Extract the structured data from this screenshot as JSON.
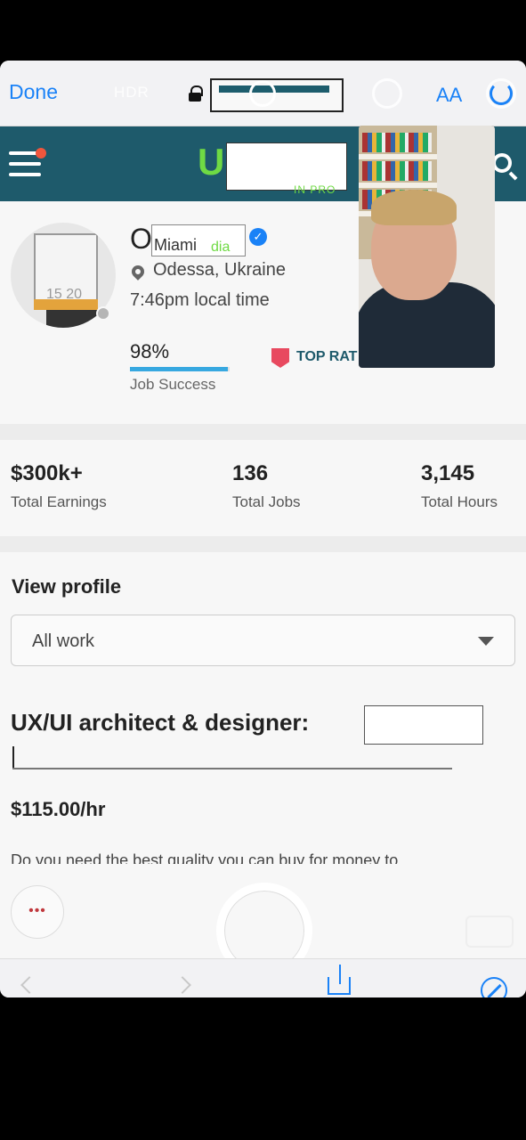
{
  "browser": {
    "done_label": "Done",
    "hdr_label": "HDR",
    "text_size_label": "AA",
    "accent": "#1a82f7"
  },
  "site": {
    "logo_text": "U",
    "logo_sub": "IN PRO",
    "header_color": "#1e5a6b",
    "brand_green": "#6fda44"
  },
  "profile": {
    "name_initial": "O",
    "name_overlay": "Miami",
    "name_overlay_suffix": "dia",
    "avatar_numbers": "15 20",
    "location": "Odessa, Ukraine",
    "local_time": "7:46pm local time",
    "job_success_value": "98%",
    "job_success_fraction": 0.98,
    "job_success_label": "Job Success",
    "badge_label": "TOP RAT"
  },
  "stats": [
    {
      "value": "$300k+",
      "label": "Total Earnings"
    },
    {
      "value": "136",
      "label": "Total Jobs"
    },
    {
      "value": "3,145",
      "label": "Total Hours"
    }
  ],
  "view_profile": {
    "title": "View profile",
    "selected_option": "All work"
  },
  "headline": "UX/UI architect & designer:",
  "rate": "$115.00/hr",
  "description": "Do you need the best quality you can buy for money to",
  "camera": {
    "more_label": "•••"
  }
}
